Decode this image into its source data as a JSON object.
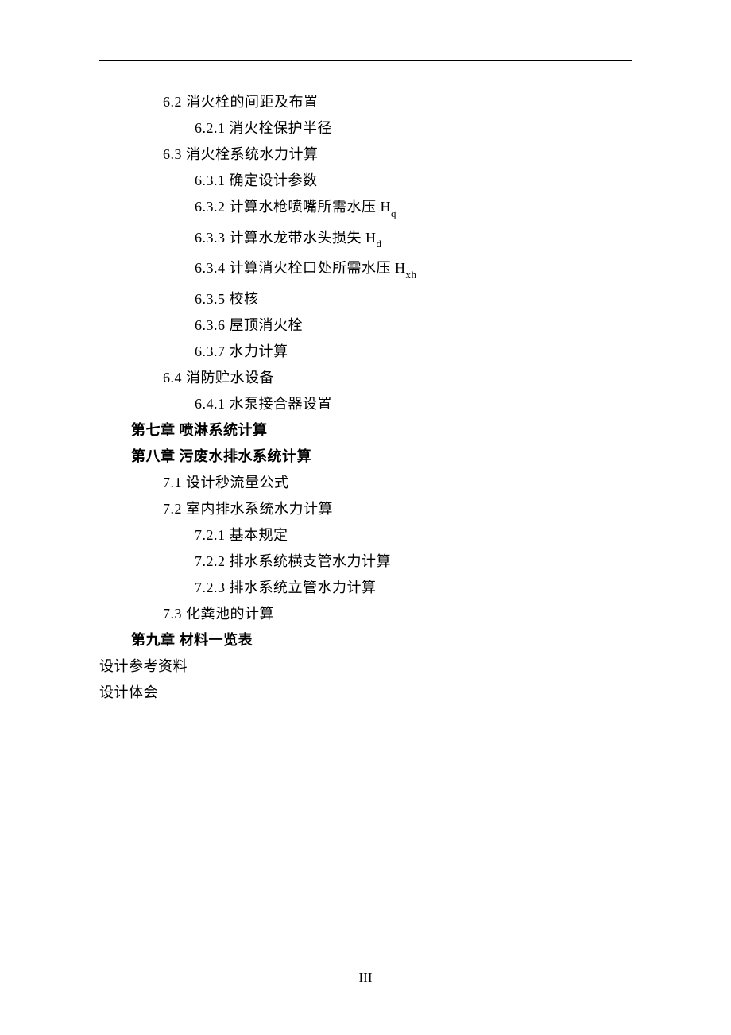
{
  "toc": {
    "i1": {
      "num": "6.2",
      "title": "消火栓的间距及布置"
    },
    "i2": {
      "num": "6.2.1",
      "title": "消火栓保护半径"
    },
    "i3": {
      "num": "6.3",
      "title": "消火栓系统水力计算"
    },
    "i4": {
      "num": "6.3.1",
      "title": "确定设计参数"
    },
    "i5": {
      "num": "6.3.2",
      "title": "计算水枪喷嘴所需水压 H",
      "sub": "q"
    },
    "i6": {
      "num": "6.3.3",
      "title": "计算水龙带水头损失 H",
      "sub": "d"
    },
    "i7": {
      "num": "6.3.4",
      "title": "计算消火栓口处所需水压 H",
      "sub": "xh"
    },
    "i8": {
      "num": "6.3.5",
      "title": "校核"
    },
    "i9": {
      "num": "6.3.6",
      "title": "屋顶消火栓"
    },
    "i10": {
      "num": "6.3.7",
      "title": "水力计算"
    },
    "i11": {
      "num": "6.4",
      "title": "消防贮水设备"
    },
    "i12": {
      "num": "6.4.1",
      "title": "水泵接合器设置"
    },
    "i13": {
      "title": "第七章 喷淋系统计算"
    },
    "i14": {
      "title": "第八章 污废水排水系统计算"
    },
    "i15": {
      "num": "7.1",
      "title": "设计秒流量公式"
    },
    "i16": {
      "num": "7.2",
      "title": "室内排水系统水力计算"
    },
    "i17": {
      "num": "7.2.1",
      "title": "基本规定"
    },
    "i18": {
      "num": "7.2.2",
      "title": "排水系统横支管水力计算"
    },
    "i19": {
      "num": "7.2.3",
      "title": "排水系统立管水力计算"
    },
    "i20": {
      "num": "7.3",
      "title": "化粪池的计算"
    },
    "i21": {
      "title": "第九章 材料一览表"
    },
    "i22": {
      "title": "设计参考资料"
    },
    "i23": {
      "title": "设计体会"
    }
  },
  "page_number": "III"
}
